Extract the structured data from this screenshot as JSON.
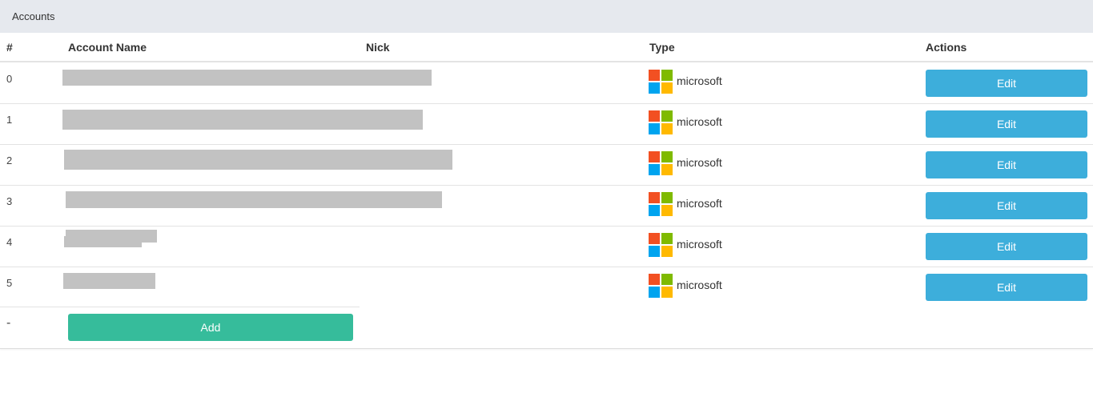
{
  "panel": {
    "title": "Accounts"
  },
  "table": {
    "columns": [
      "#",
      "Account Name",
      "Nick",
      "Type",
      "Actions"
    ],
    "rows": [
      {
        "index": "0",
        "type": "microsoft",
        "action": "Edit"
      },
      {
        "index": "1",
        "type": "microsoft",
        "action": "Edit"
      },
      {
        "index": "2",
        "type": "microsoft",
        "action": "Edit"
      },
      {
        "index": "3",
        "type": "microsoft",
        "action": "Edit"
      },
      {
        "index": "4",
        "type": "microsoft",
        "action": "Edit"
      },
      {
        "index": "5",
        "type": "microsoft",
        "action": "Edit"
      }
    ],
    "add_row": {
      "index": "-",
      "button": "Add"
    }
  },
  "colors": {
    "edit_button": "#3daedb",
    "add_button": "#36bc9b",
    "header_bg": "#e6e9ee",
    "redaction": "#c2c2c2"
  },
  "icons": {
    "type_icon": "microsoft-logo-icon"
  }
}
